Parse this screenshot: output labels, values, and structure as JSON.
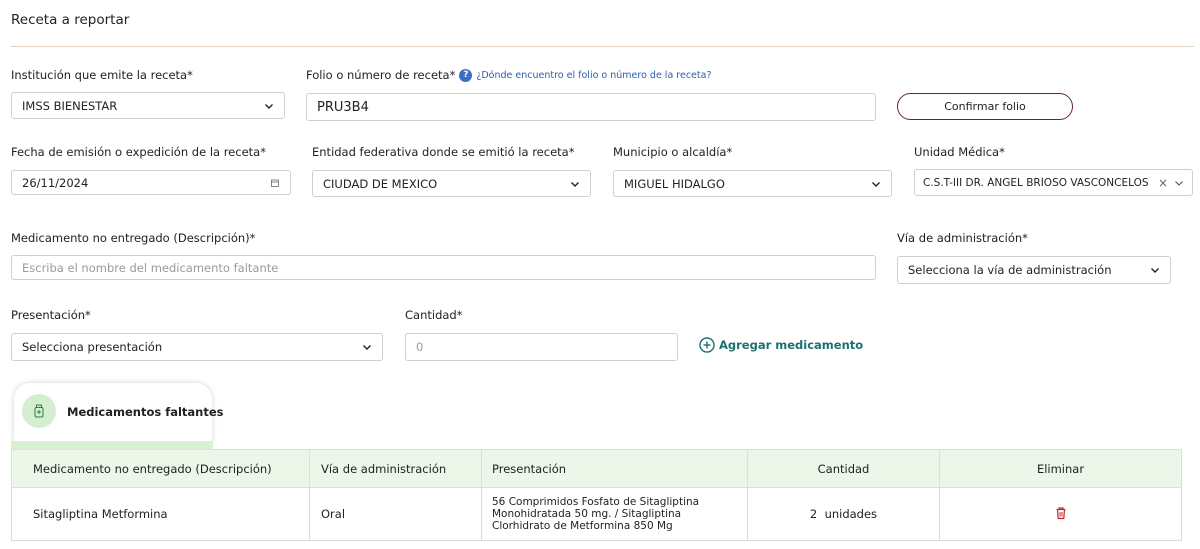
{
  "section": {
    "title": "Receta a reportar"
  },
  "institucion": {
    "label": "Institución que emite la receta*",
    "value": "IMSS BIENESTAR"
  },
  "folio": {
    "label": "Folio o número de receta*",
    "help_link": "¿Dónde encuentro el folio o número de la receta?",
    "value": "PRU3B4",
    "confirm_label": "Confirmar folio"
  },
  "fecha": {
    "label": "Fecha de emisión o expedición de la receta*",
    "value": "26/11/2024"
  },
  "entidad": {
    "label": "Entidad federativa donde se emitió la receta*",
    "value": "CIUDAD DE MEXICO"
  },
  "municipio": {
    "label": "Municipio o alcaldía*",
    "value": "MIGUEL HIDALGO"
  },
  "unidad": {
    "label": "Unidad Médica*",
    "value": "C.S.T-III DR. ÁNGEL BRÍOSO VASCONCELOS"
  },
  "medicamento": {
    "label": "Medicamento no entregado (Descripción)*",
    "placeholder": "Escriba el nombre del medicamento faltante"
  },
  "via": {
    "label": "Vía de administración*",
    "value": "Selecciona la vía de administración"
  },
  "presentacion": {
    "label": "Presentación*",
    "value": "Selecciona presentación"
  },
  "cantidad": {
    "label": "Cantidad*",
    "placeholder": "0"
  },
  "add_label": "Agregar medicamento",
  "tab": {
    "label": "Medicamentos faltantes"
  },
  "table": {
    "headers": [
      "Medicamento no entregado (Descripción)",
      "Vía de administración",
      "Presentación",
      "Cantidad",
      "Eliminar"
    ],
    "rows": [
      {
        "medicamento": "Sitagliptina Metformina",
        "via": "Oral",
        "presentacion": "56 Comprimidos Fosfato de Sitagliptina Monohidratada 50 mg. / Sitagliptina Clorhidrato de Metformina 850 Mg",
        "cantidad": "2",
        "unidades": "unidades"
      }
    ]
  },
  "colors": {
    "accent": "#6b2336",
    "link": "#2f5fa6",
    "tab_green": "#d3efd0",
    "table_header": "#ecf7ea",
    "delete": "#c0262d"
  }
}
